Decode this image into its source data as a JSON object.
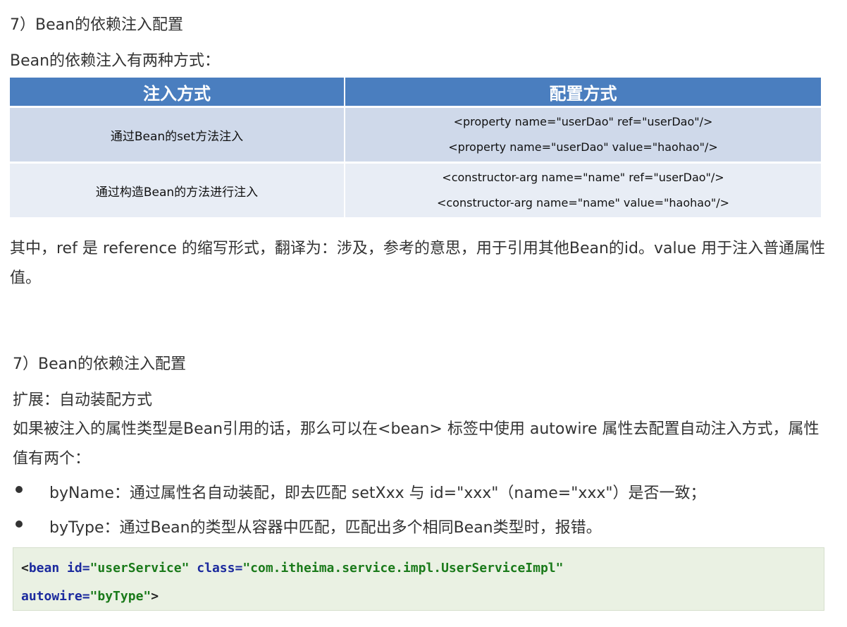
{
  "section1": {
    "heading": "7）Bean的依赖注入配置",
    "intro": "Bean的依赖注入有两种方式：",
    "table": {
      "headers": [
        "注入方式",
        "配置方式"
      ],
      "rows": [
        {
          "method": "通过Bean的set方法注入",
          "configs": [
            "<property name=\"userDao\" ref=\"userDao\"/>",
            "<property name=\"userDao\" value=\"haohao\"/>"
          ]
        },
        {
          "method": "通过构造Bean的方法进行注入",
          "configs": [
            "<constructor-arg name=\"name\" ref=\"userDao\"/>",
            "<constructor-arg name=\"name\" value=\"haohao\"/>"
          ]
        }
      ]
    },
    "note": "其中，ref 是 reference 的缩写形式，翻译为：涉及，参考的意思，用于引用其他Bean的id。value 用于注入普通属性值。"
  },
  "section2": {
    "heading": "7）Bean的依赖注入配置",
    "subheading": "扩展：自动装配方式",
    "paragraph": "如果被注入的属性类型是Bean引用的话，那么可以在<bean> 标签中使用 autowire 属性去配置自动注入方式，属性值有两个：",
    "bullets": [
      "byName：通过属性名自动装配，即去匹配 setXxx 与 id=\"xxx\"（name=\"xxx\"）是否一致；",
      "byType：通过Bean的类型从容器中匹配，匹配出多个相同Bean类型时，报错。"
    ],
    "code": {
      "open": "<",
      "tag": "bean",
      "attr_id": "id=",
      "val_id": "\"userService\"",
      "attr_class": "class=",
      "val_class": "\"com.itheima.service.impl.UserServiceImpl\"",
      "attr_autowire": "autowire=",
      "val_autowire": "\"byType\"",
      "close": ">"
    }
  },
  "colors": {
    "header_bg": "#4a7ebf",
    "row1_bg": "#cfd9ea",
    "row2_bg": "#e8edf5",
    "code_bg": "#eaf1e3",
    "keyword": "#1b2a9e",
    "string": "#1a7a1a"
  }
}
